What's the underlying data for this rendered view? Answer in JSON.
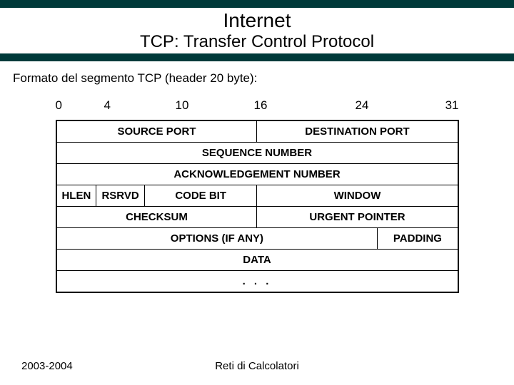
{
  "header": {
    "title1": "Internet",
    "title2": "TCP: Transfer Control Protocol"
  },
  "description": "Formato del segmento TCP  (header 20 byte):",
  "bit_labels": [
    "0",
    "4",
    "10",
    "16",
    "24",
    "31"
  ],
  "rows": {
    "r1": {
      "source_port": "SOURCE PORT",
      "dest_port": "DESTINATION PORT"
    },
    "r2": {
      "seq": "SEQUENCE NUMBER"
    },
    "r3": {
      "ack": "ACKNOWLEDGEMENT NUMBER"
    },
    "r4": {
      "hlen": "HLEN",
      "rsrvd": "RSRVD",
      "code": "CODE BIT",
      "window": "WINDOW"
    },
    "r5": {
      "checksum": "CHECKSUM",
      "urgent": "URGENT POINTER"
    },
    "r6": {
      "options": "OPTIONS (IF ANY)",
      "padding": "PADDING"
    },
    "r7": {
      "data": "DATA"
    },
    "r8": {
      "dots": ". . ."
    }
  },
  "footer": {
    "year": "2003-2004",
    "course": "Reti di Calcolatori"
  }
}
